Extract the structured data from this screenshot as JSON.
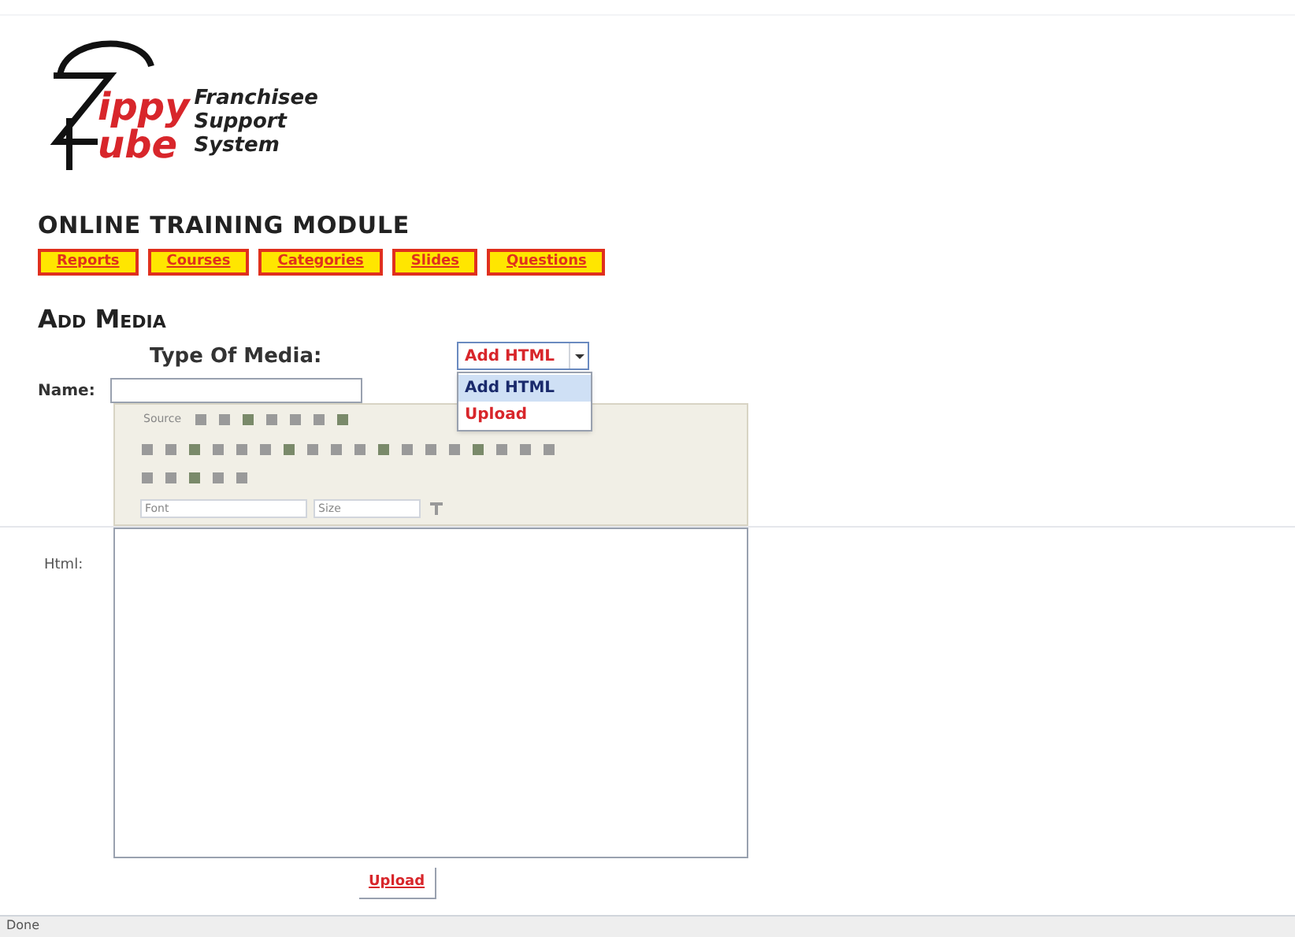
{
  "logo": {
    "letters": [
      "ippy",
      "ube"
    ],
    "tagline": [
      "Franchisee",
      "Support",
      "System"
    ]
  },
  "title": "ONLINE TRAINING MODULE",
  "nav": [
    "Reports",
    "Courses",
    "Categories",
    "Slides",
    "Questions"
  ],
  "heading": "Add Media",
  "media_type": {
    "label": "Type Of Media:",
    "value": "Add HTML",
    "expanded": true,
    "options": [
      {
        "label": "Add HTML",
        "selected": true
      },
      {
        "label": "Upload",
        "selected": false
      }
    ]
  },
  "name_field": {
    "label": "Name:"
  },
  "editor": {
    "source_label": "Source",
    "font_label": "Font",
    "size_label": "Size"
  },
  "html_field": {
    "label": "Html:"
  },
  "submit": "Upload",
  "status_bar": "Done"
}
